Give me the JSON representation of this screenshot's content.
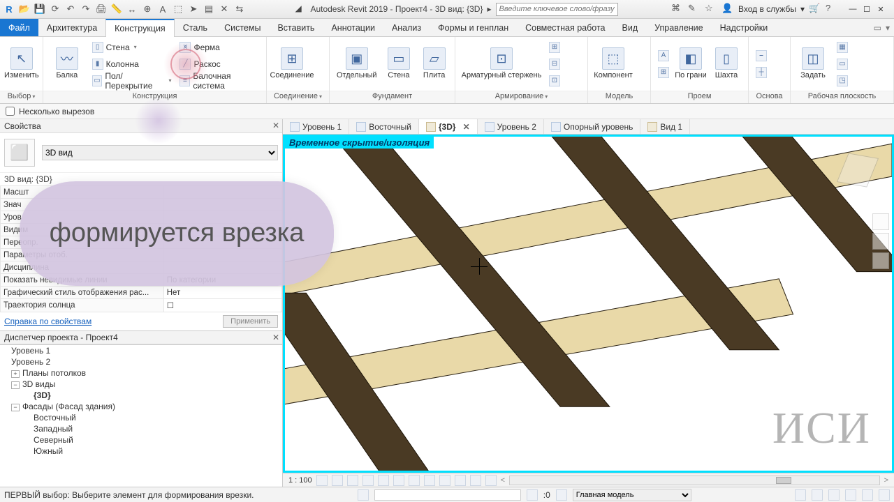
{
  "app": {
    "title": "Autodesk Revit 2019 - Проект4 - 3D вид: {3D}",
    "search_placeholder": "Введите ключевое слово/фразу",
    "login": "Вход в службы"
  },
  "ribbon_tabs": {
    "file": "Файл",
    "items": [
      "Архитектура",
      "Конструкция",
      "Сталь",
      "Системы",
      "Вставить",
      "Аннотации",
      "Анализ",
      "Формы и генплан",
      "Совместная работа",
      "Вид",
      "Управление",
      "Надстройки"
    ],
    "active_index": 1
  },
  "ribbon": {
    "select": {
      "modify": "Изменить",
      "group": "Выбор"
    },
    "structure": {
      "beam": "Балка",
      "wall": "Стена",
      "column": "Колонна",
      "floor": "Пол/Перекрытие",
      "truss": "Ферма",
      "brace": "Раскос",
      "beamSystem": "Балочная система",
      "group": "Конструкция"
    },
    "connection": {
      "btn": "Соединение",
      "group": "Соединение"
    },
    "foundation": {
      "isolated": "Отдельный",
      "wall": "Стена",
      "slab": "Плита",
      "group": "Фундамент"
    },
    "reinforcement": {
      "rebar": "Арматурный стержень",
      "group": "Армирование"
    },
    "model": {
      "component": "Компонент",
      "group": "Модель"
    },
    "opening": {
      "byface": "По грани",
      "shaft": "Шахта",
      "group": "Проем"
    },
    "datum": {
      "group": "Основа"
    },
    "workplane": {
      "set": "Задать",
      "group": "Рабочая плоскость"
    }
  },
  "options_bar": {
    "multicut": "Несколько вырезов"
  },
  "properties": {
    "title": "Свойства",
    "type": "3D вид",
    "header": "3D вид: {3D}",
    "rows": [
      {
        "k": "Масшт",
        "v": ""
      },
      {
        "k": "Знач",
        "v": ""
      },
      {
        "k": "Уров",
        "v": ""
      },
      {
        "k": "Видим",
        "v": ""
      },
      {
        "k": "Переопр.",
        "v": ""
      },
      {
        "k": "Параметры отоб.",
        "v": ""
      },
      {
        "k": "Дисциплина",
        "v": ""
      },
      {
        "k": "Показать невидимые линии",
        "v": "По категории"
      },
      {
        "k": "Графический стиль отображения рас...",
        "v": "Нет"
      },
      {
        "k": "Траектория солнца",
        "v": "☐"
      }
    ],
    "help": "Справка по свойствам",
    "apply": "Применить"
  },
  "browser": {
    "title": "Диспетчер проекта - Проект4",
    "items": {
      "lvl1": "Уровень 1",
      "lvl2": "Уровень 2",
      "ceil": "Планы потолков",
      "views3d": "3D виды",
      "view3d": "{3D}",
      "facades": "Фасады (Фасад здания)",
      "east": "Восточный",
      "west": "Западный",
      "north": "Северный",
      "south": "Южный"
    }
  },
  "view_tabs": [
    {
      "label": "Уровень 1",
      "icon": "plan"
    },
    {
      "label": "Восточный",
      "icon": "plan"
    },
    {
      "label": "{3D}",
      "icon": "cube",
      "active": true,
      "closable": true
    },
    {
      "label": "Уровень 2",
      "icon": "plan"
    },
    {
      "label": "Опорный уровень",
      "icon": "plan"
    },
    {
      "label": "Вид 1",
      "icon": "cube"
    }
  ],
  "canvas": {
    "banner": "Временное скрытие/изоляция",
    "watermark": "ИСИ",
    "scale": "1 : 100"
  },
  "status": {
    "prompt": "ПЕРВЫЙ выбор: Выберите элемент для формирования врезки.",
    "zero": ":0",
    "model": "Главная модель"
  },
  "callout": "формируется врезка"
}
